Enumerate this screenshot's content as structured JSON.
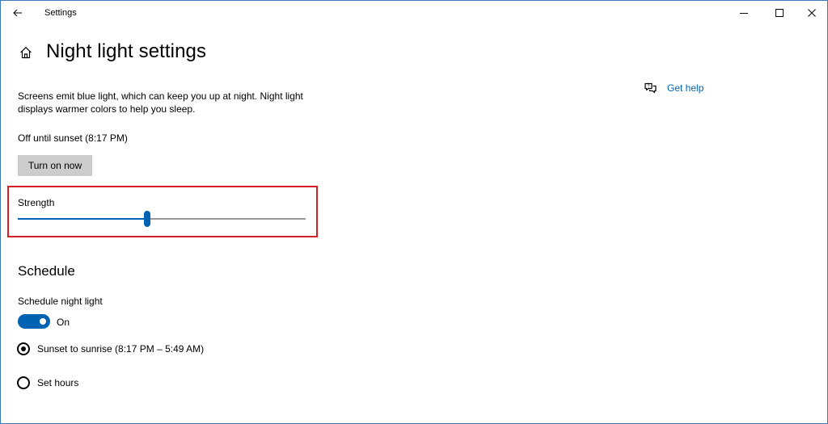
{
  "window": {
    "app_title": "Settings"
  },
  "page": {
    "title": "Night light settings",
    "description": "Screens emit blue light, which can keep you up at night. Night light displays warmer colors to help you sleep.",
    "status": "Off until sunset (8:17 PM)",
    "turn_on_label": "Turn on now"
  },
  "help": {
    "label": "Get help"
  },
  "strength": {
    "label": "Strength",
    "value_percent": 45
  },
  "schedule": {
    "section_title": "Schedule",
    "toggle_label": "Schedule night light",
    "toggle_state": "On",
    "options": [
      {
        "label": "Sunset to sunrise (8:17 PM – 5:49 AM)",
        "checked": true
      },
      {
        "label": "Set hours",
        "checked": false
      }
    ]
  },
  "colors": {
    "accent": "#0063b1",
    "highlight": "#d42027",
    "button_bg": "#cccccc"
  }
}
